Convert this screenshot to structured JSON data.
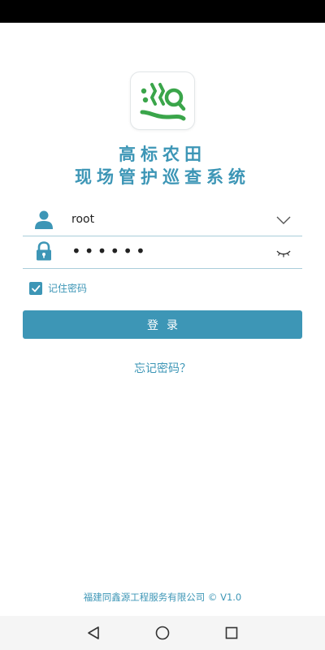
{
  "app": {
    "title_line1": "高标农田",
    "title_line2": "现场管护巡查系统",
    "logo_icon": "xun-character-logo"
  },
  "colors": {
    "accent": "#3d96b6",
    "logo_green": "#3aa54a"
  },
  "login": {
    "username_value": "root",
    "password_masked": "••••••",
    "user_icon": "user-icon",
    "lock_icon": "lock-icon",
    "dropdown_icon": "chevron-down-icon",
    "visibility_icon": "eye-closed-icon",
    "remember_label": "记住密码",
    "remember_checked": true,
    "login_button_label": "登录",
    "forgot_label": "忘记密码？"
  },
  "footer": {
    "copyright": "福建同鑫源工程服务有限公司 © V1.0"
  },
  "nav": {
    "back_icon": "back-triangle-icon",
    "home_icon": "home-circle-icon",
    "recent_icon": "recent-square-icon"
  }
}
